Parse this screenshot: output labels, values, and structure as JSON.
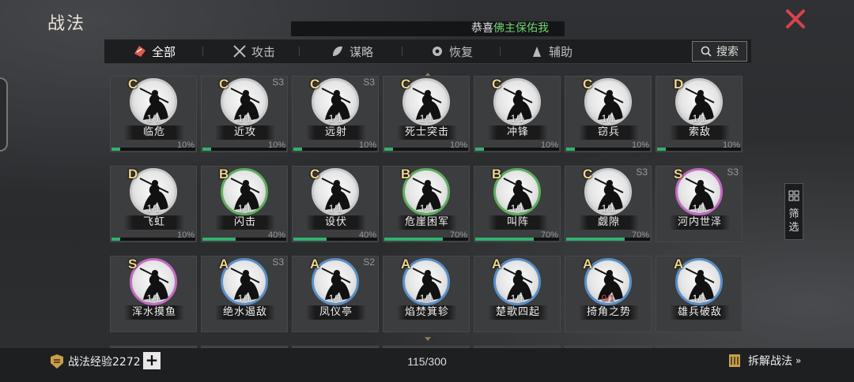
{
  "header": {
    "title": "战法",
    "ticker_prefix": "恭喜",
    "ticker_name": "佛主保佑我"
  },
  "tabs": [
    {
      "label": "全部",
      "icon": "all-icon",
      "active": true
    },
    {
      "label": "攻击",
      "icon": "swords-icon",
      "active": false
    },
    {
      "label": "谋略",
      "icon": "strategy-icon",
      "active": false
    },
    {
      "label": "恢复",
      "icon": "recovery-icon",
      "active": false
    },
    {
      "label": "辅助",
      "icon": "support-icon",
      "active": false
    }
  ],
  "search": {
    "label": "搜索"
  },
  "filter": {
    "label": "筛选"
  },
  "cards": [
    {
      "grade": "C",
      "season": "",
      "level": "1/1",
      "name": "临危",
      "percent": "10%",
      "progress": 0.1
    },
    {
      "grade": "C",
      "season": "S3",
      "level": "1/1",
      "name": "近攻",
      "percent": "10%",
      "progress": 0.1
    },
    {
      "grade": "C",
      "season": "S3",
      "level": "1/1",
      "name": "远射",
      "percent": "10%",
      "progress": 0.1
    },
    {
      "grade": "C",
      "season": "",
      "level": "1/1",
      "name": "死士突击",
      "percent": "10%",
      "progress": 0.1
    },
    {
      "grade": "C",
      "season": "",
      "level": "1/1",
      "name": "冲锋",
      "percent": "10%",
      "progress": 0.1
    },
    {
      "grade": "C",
      "season": "",
      "level": "1/1",
      "name": "窃兵",
      "percent": "10%",
      "progress": 0.1
    },
    {
      "grade": "D",
      "season": "",
      "level": "1/1",
      "name": "索敌",
      "percent": "10%",
      "progress": 0.1
    },
    {
      "grade": "D",
      "season": "",
      "level": "1/1",
      "name": "飞虹",
      "percent": "10%",
      "progress": 0.1
    },
    {
      "grade": "B",
      "season": "",
      "level": "1/1",
      "name": "闪击",
      "percent": "40%",
      "progress": 0.4
    },
    {
      "grade": "C",
      "season": "",
      "level": "1/1",
      "name": "设伏",
      "percent": "40%",
      "progress": 0.4
    },
    {
      "grade": "B",
      "season": "",
      "level": "1/1",
      "name": "危崖困军",
      "percent": "70%",
      "progress": 0.7
    },
    {
      "grade": "B",
      "season": "",
      "level": "1/1",
      "name": "叫阵",
      "percent": "70%",
      "progress": 0.7
    },
    {
      "grade": "C",
      "season": "S3",
      "level": "1/1",
      "name": "觑隙",
      "percent": "70%",
      "progress": 0.7
    },
    {
      "grade": "S",
      "season": "S3",
      "level": "1/1",
      "name": "河内世泽",
      "percent": "",
      "progress": 0
    },
    {
      "grade": "S",
      "season": "",
      "level": "1/1",
      "name": "浑水摸鱼",
      "percent": "",
      "progress": 0
    },
    {
      "grade": "A",
      "season": "S3",
      "level": "1/1",
      "name": "绝水遏敌",
      "percent": "",
      "progress": 0
    },
    {
      "grade": "A",
      "season": "S2",
      "level": "1/1",
      "name": "凤仪亭",
      "percent": "",
      "progress": 0
    },
    {
      "grade": "A",
      "season": "",
      "level": "1/1",
      "name": "焰焚箕轸",
      "percent": "",
      "progress": 0
    },
    {
      "grade": "A",
      "season": "",
      "level": "1/1",
      "name": "楚歌四起",
      "percent": "",
      "progress": 0
    },
    {
      "grade": "A",
      "season": "",
      "level": "0/1",
      "name": "掎角之势",
      "percent": "",
      "progress": 0
    },
    {
      "grade": "A",
      "season": "",
      "level": "1/1",
      "name": "雄兵破敌",
      "percent": "",
      "progress": 0
    }
  ],
  "footer": {
    "exp_label": "战法经验2272",
    "plus": "+",
    "count": "115/300",
    "split_label": "拆解战法"
  },
  "colors": {
    "grade_S": "#c46ac2",
    "grade_A": "#5a8fc8",
    "grade_B": "#5fae5f",
    "grade_C": "#c9c9c9",
    "grade_D": "#c9c9c9",
    "progress": "#2fb36e",
    "ticker_name": "#6fd36f",
    "close": "#d8424a"
  }
}
